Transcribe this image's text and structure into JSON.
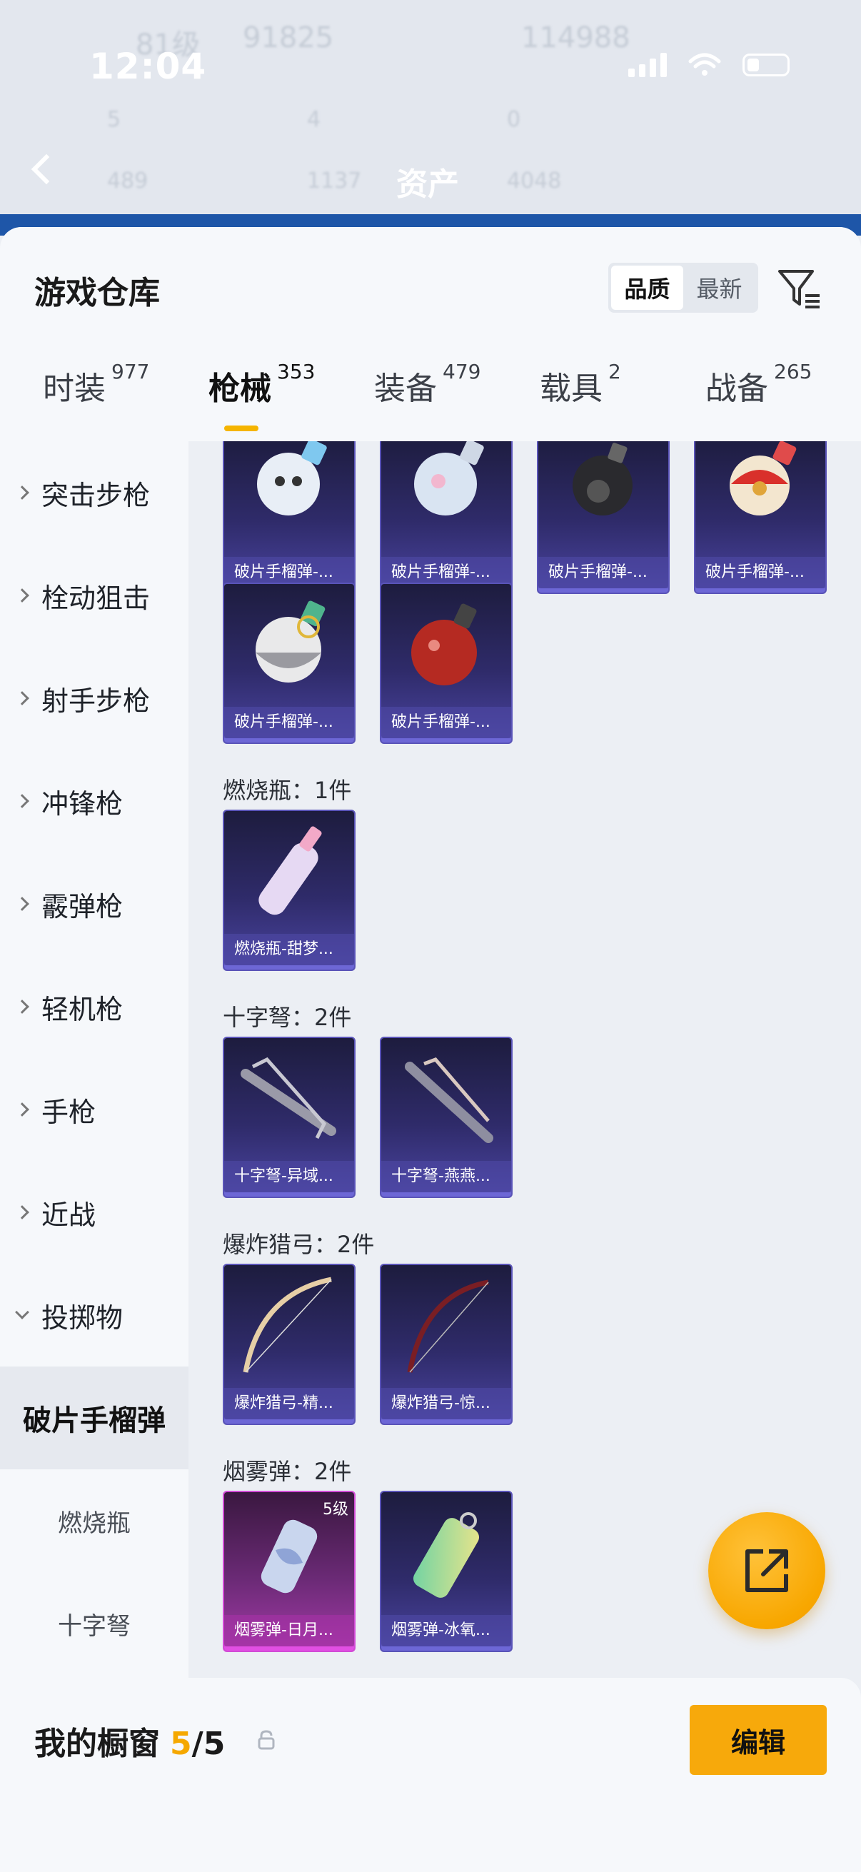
{
  "status_bar": {
    "time": "12:04"
  },
  "background_header": {
    "title": "资产",
    "ghost_stats": [
      "81级",
      "91825",
      "114988",
      "5",
      "4",
      "0",
      "489",
      "1137",
      "4048"
    ]
  },
  "sheet": {
    "title": "游戏仓库",
    "sort_options": [
      "品质",
      "最新"
    ],
    "sort_active": "品质",
    "tabs": [
      {
        "label": "时装",
        "count": "977"
      },
      {
        "label": "枪械",
        "count": "353"
      },
      {
        "label": "装备",
        "count": "479"
      },
      {
        "label": "载具",
        "count": "2"
      },
      {
        "label": "战备",
        "count": "265"
      }
    ],
    "active_tab": "枪械"
  },
  "categories": [
    {
      "label": "突击步枪",
      "state": "collapsed"
    },
    {
      "label": "栓动狙击",
      "state": "collapsed"
    },
    {
      "label": "射手步枪",
      "state": "collapsed"
    },
    {
      "label": "冲锋枪",
      "state": "collapsed"
    },
    {
      "label": "霰弹枪",
      "state": "collapsed"
    },
    {
      "label": "轻机枪",
      "state": "collapsed"
    },
    {
      "label": "手枪",
      "state": "collapsed"
    },
    {
      "label": "近战",
      "state": "collapsed"
    },
    {
      "label": "投掷物",
      "state": "expanded"
    },
    {
      "label": "破片手榴弹",
      "state": "selected"
    },
    {
      "label": "燃烧瓶",
      "state": "sub"
    },
    {
      "label": "十字弩",
      "state": "sub"
    }
  ],
  "groups": {
    "frag": {
      "items": [
        "破片手榴弹-...",
        "破片手榴弹-...",
        "破片手榴弹-...",
        "破片手榴弹-...",
        "破片手榴弹-...",
        "破片手榴弹-..."
      ]
    },
    "molotov": {
      "title": "燃烧瓶：1件",
      "items": [
        "燃烧瓶-甜梦..."
      ]
    },
    "crossbow": {
      "title": "十字弩：2件",
      "items": [
        "十字弩-异域...",
        "十字弩-燕燕..."
      ]
    },
    "bow": {
      "title": "爆炸猎弓：2件",
      "items": [
        "爆炸猎弓-精...",
        "爆炸猎弓-惊..."
      ]
    },
    "smoke": {
      "title": "烟雾弹：2件",
      "items": [
        "烟雾弹-日月...",
        "烟雾弹-冰氧..."
      ],
      "level_badge": "5级"
    }
  },
  "bottom_bar": {
    "label": "我的橱窗",
    "current": "5",
    "separator": "/",
    "max": "5",
    "edit_label": "编辑"
  },
  "colors": {
    "accent": "#f7a90b",
    "item_blue": "#4a44a0",
    "item_pink": "#a23aa6",
    "header_blue": "#1e56a8"
  }
}
